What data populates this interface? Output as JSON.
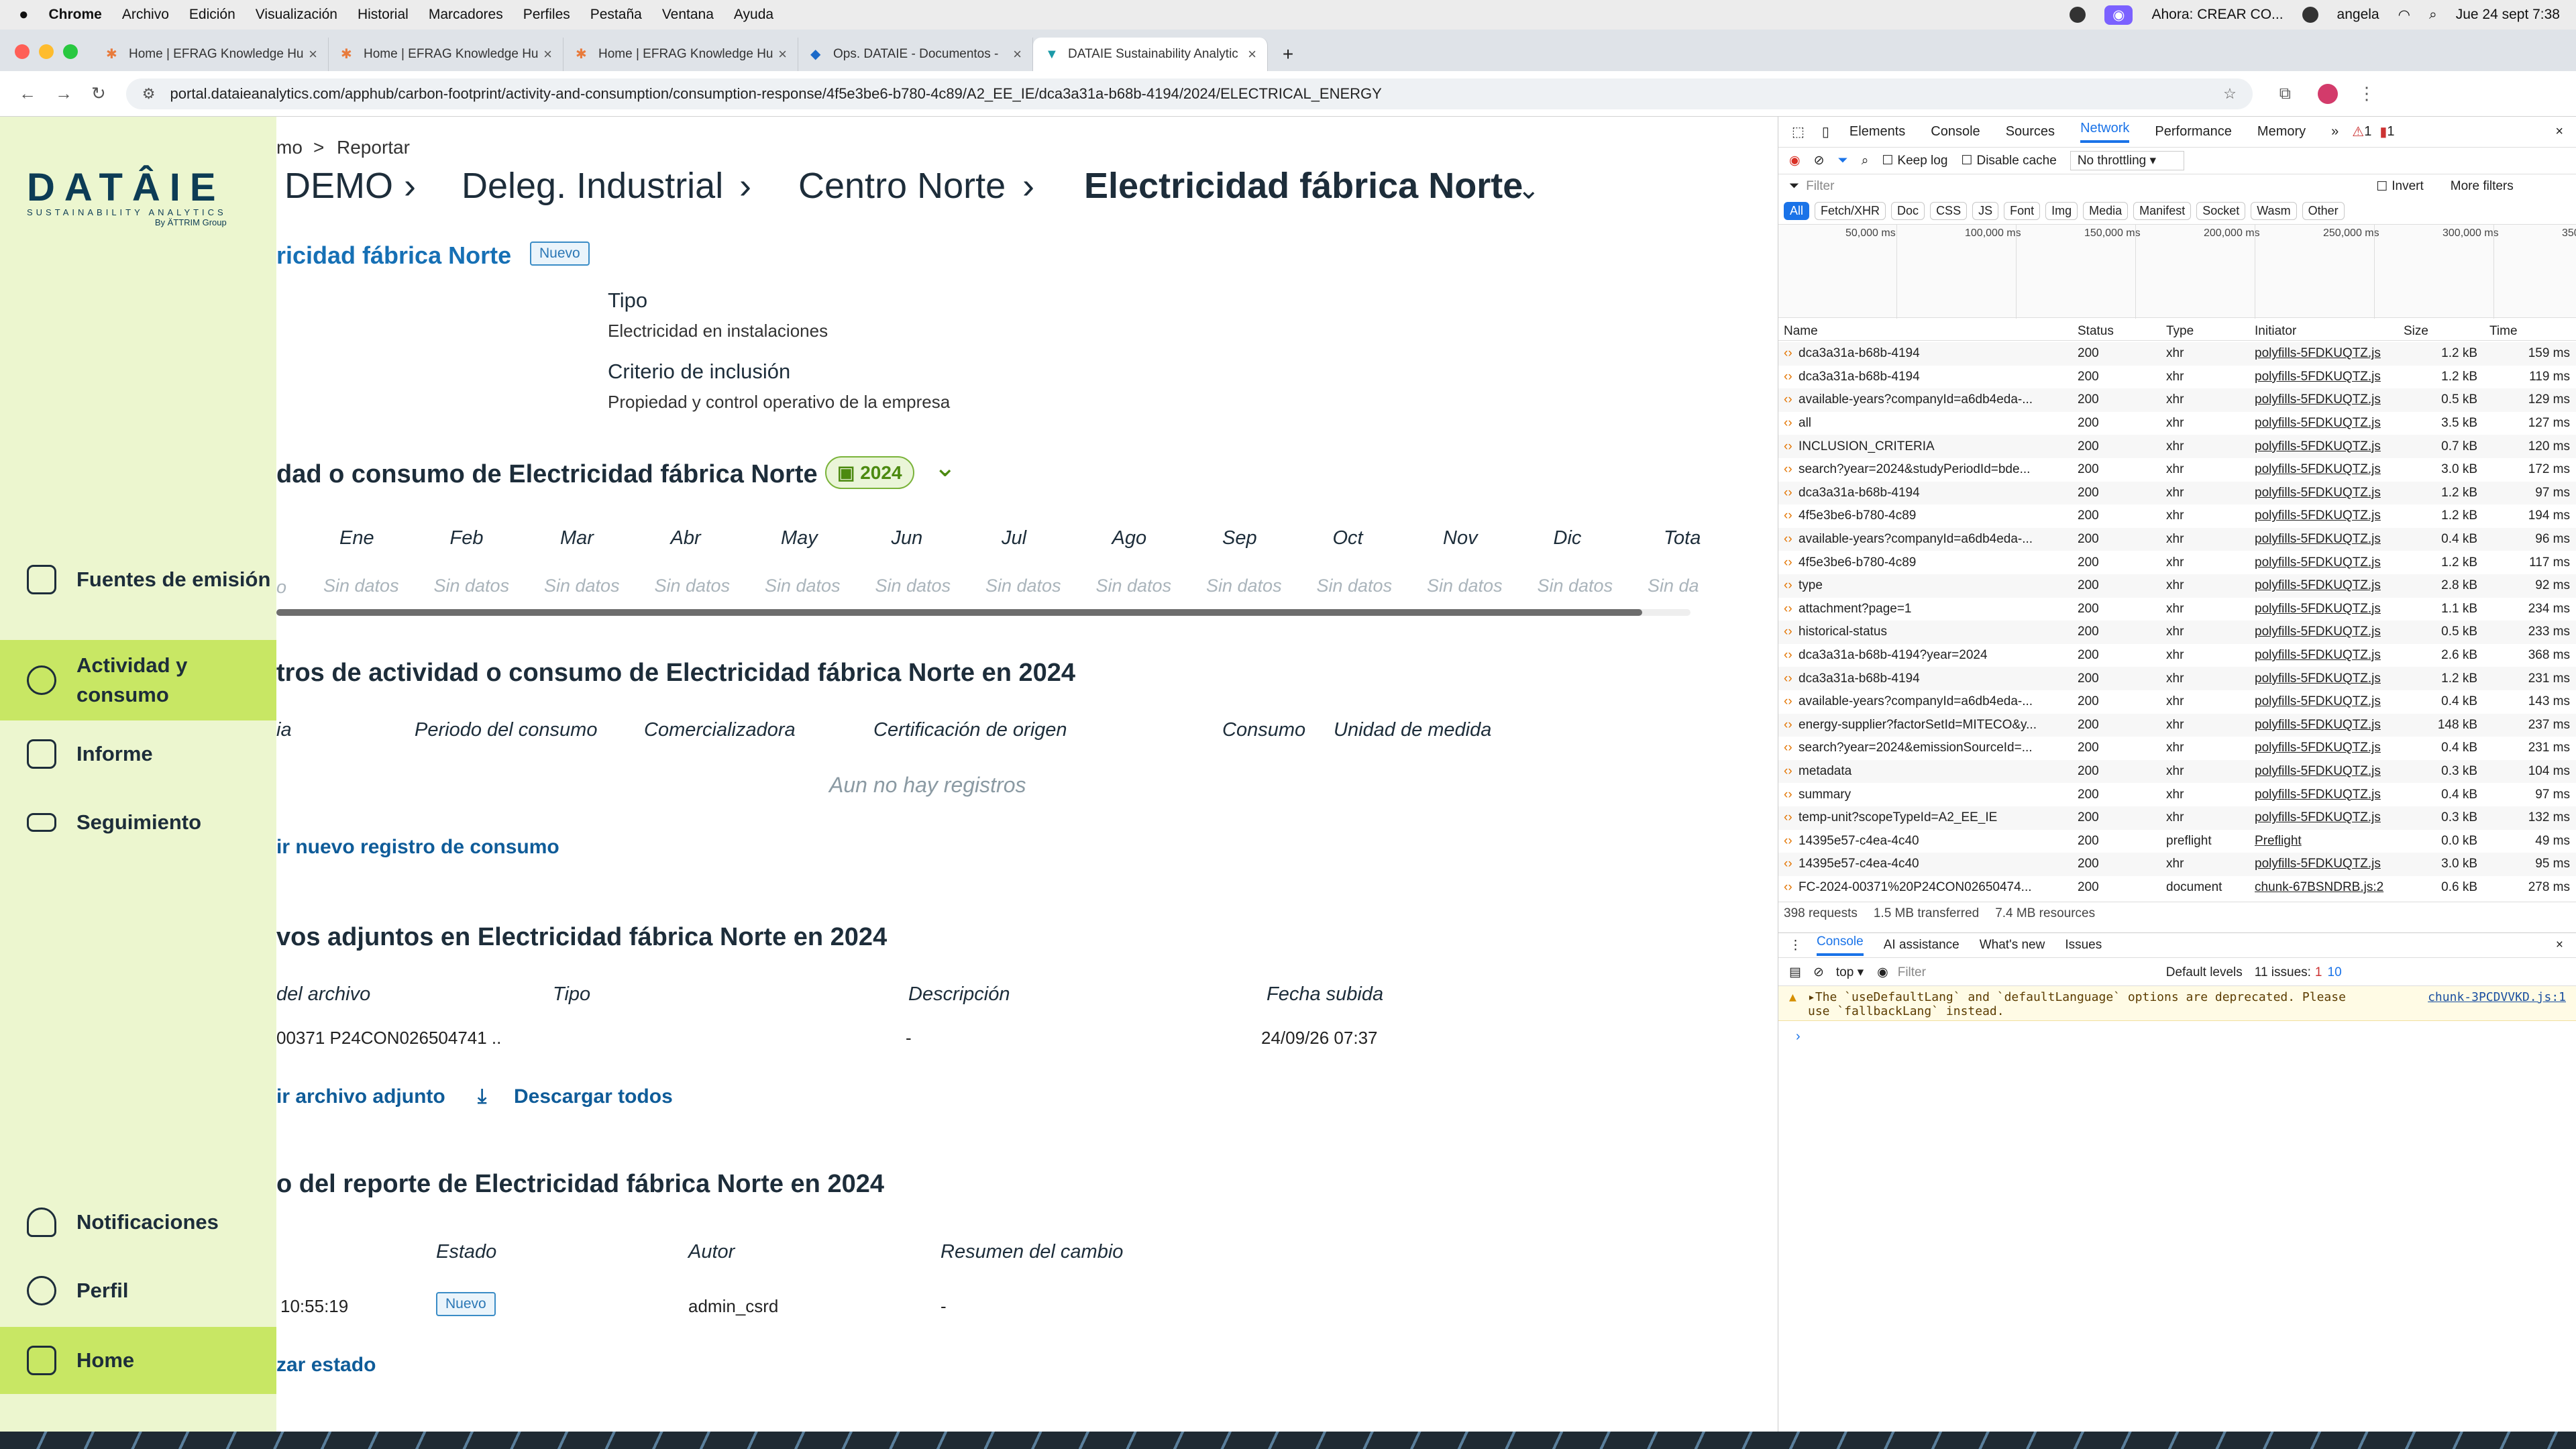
{
  "menubar": {
    "app": "Chrome",
    "items": [
      "Archivo",
      "Edición",
      "Visualización",
      "Historial",
      "Marcadores",
      "Perfiles",
      "Pestaña",
      "Ventana",
      "Ayuda"
    ],
    "now_playing": "Ahora: CREAR CO...",
    "user": "angela",
    "datetime": "Jue 24 sept 7:38"
  },
  "tabs": [
    {
      "label": "Home | EFRAG Knowledge Hu"
    },
    {
      "label": "Home | EFRAG Knowledge Hu"
    },
    {
      "label": "Home | EFRAG Knowledge Hu"
    },
    {
      "label": "Ops. DATAIE - Documentos -"
    },
    {
      "label": "DATAIE Sustainability Analytic"
    }
  ],
  "url": "portal.dataieanalytics.com/apphub/carbon-footprint/activity-and-consumption/consumption-response/4f5e3be6-b780-4c89/A2_EE_IE/dca3a31a-b68b-4194/2024/ELECTRICAL_ENERGY",
  "logo": {
    "word": "DATÂIE",
    "sub": "SUSTAINABILITY ANALYTICS",
    "by": "By ÄTTRIM Group"
  },
  "nav": {
    "fuentes": "Fuentes de emisión",
    "actividad": "Actividad y consumo",
    "informe": "Informe",
    "seguimiento": "Seguimiento",
    "notificaciones": "Notificaciones",
    "perfil": "Perfil",
    "home": "Home"
  },
  "breadcrumb": {
    "small_prev": "mo",
    "small_sep": ">",
    "small_current": "Reportar",
    "path": [
      "DEMO",
      "Deleg. Industrial",
      "Centro Norte"
    ],
    "current": "Electricidad fábrica Norte"
  },
  "source": {
    "title": "ricidad fábrica Norte",
    "badge": "Nuevo",
    "tipo_label": "Tipo",
    "tipo_value": "Electricidad en instalaciones",
    "criterio_label": "Criterio de inclusión",
    "criterio_value": "Propiedad y control operativo de la empresa"
  },
  "monthly": {
    "title": "dad o consumo de Electricidad fábrica Norte",
    "year": "2024",
    "months": [
      "Ene",
      "Feb",
      "Mar",
      "Abr",
      "May",
      "Jun",
      "Jul",
      "Ago",
      "Sep",
      "Oct",
      "Nov",
      "Dic",
      "Tota"
    ],
    "row_first": "o",
    "empty": "Sin datos",
    "total_empty": "Sin da"
  },
  "records": {
    "title": "tros de actividad o consumo de Electricidad fábrica Norte en 2024",
    "cols": [
      "ia",
      "Periodo del consumo",
      "Comercializadora",
      "Certificación de origen",
      "Consumo",
      "Unidad de medida"
    ],
    "empty": "Aun no hay registros",
    "add": "ir nuevo registro de consumo"
  },
  "attachments": {
    "title": "vos adjuntos en Electricidad fábrica Norte en 2024",
    "cols": [
      "del archivo",
      "Tipo",
      "Descripción",
      "Fecha subida"
    ],
    "row": {
      "name": "00371 P24CON026504741 ..",
      "tipo": "",
      "desc": "-",
      "fecha": "24/09/26 07:37"
    },
    "add": "ir archivo adjunto",
    "download": "Descargar todos"
  },
  "history": {
    "title": "o del reporte de Electricidad fábrica Norte en 2024",
    "cols": [
      "Estado",
      "Autor",
      "Resumen del cambio"
    ],
    "row": {
      "time": "10:55:19",
      "estado": "Nuevo",
      "autor": "admin_csrd",
      "resumen": "-"
    },
    "action": "zar estado"
  },
  "devtools": {
    "tabs": [
      "Elements",
      "Console",
      "Sources",
      "Network",
      "Performance",
      "Memory"
    ],
    "warn_count": "1",
    "err_count": "1",
    "keep_log": "Keep log",
    "disable_cache": "Disable cache",
    "throttle": "No throttling",
    "filter": "Filter",
    "invert": "Invert",
    "more_filters": "More filters",
    "types": [
      "All",
      "Fetch/XHR",
      "Doc",
      "CSS",
      "JS",
      "Font",
      "Img",
      "Media",
      "Manifest",
      "Socket",
      "Wasm",
      "Other"
    ],
    "timeline": [
      "50,000 ms",
      "100,000 ms",
      "150,000 ms",
      "200,000 ms",
      "250,000 ms",
      "300,000 ms",
      "350"
    ],
    "headers": [
      "Name",
      "Status",
      "Type",
      "Initiator",
      "Size",
      "Time"
    ],
    "rows": [
      [
        "dca3a31a-b68b-4194",
        "200",
        "xhr",
        "polyfills-5FDKUQTZ.js",
        "1.2 kB",
        "159 ms"
      ],
      [
        "dca3a31a-b68b-4194",
        "200",
        "xhr",
        "polyfills-5FDKUQTZ.js",
        "1.2 kB",
        "119 ms"
      ],
      [
        "available-years?companyId=a6db4eda-...",
        "200",
        "xhr",
        "polyfills-5FDKUQTZ.js",
        "0.5 kB",
        "129 ms"
      ],
      [
        "all",
        "200",
        "xhr",
        "polyfills-5FDKUQTZ.js",
        "3.5 kB",
        "127 ms"
      ],
      [
        "INCLUSION_CRITERIA",
        "200",
        "xhr",
        "polyfills-5FDKUQTZ.js",
        "0.7 kB",
        "120 ms"
      ],
      [
        "search?year=2024&studyPeriodId=bde...",
        "200",
        "xhr",
        "polyfills-5FDKUQTZ.js",
        "3.0 kB",
        "172 ms"
      ],
      [
        "dca3a31a-b68b-4194",
        "200",
        "xhr",
        "polyfills-5FDKUQTZ.js",
        "1.2 kB",
        "97 ms"
      ],
      [
        "4f5e3be6-b780-4c89",
        "200",
        "xhr",
        "polyfills-5FDKUQTZ.js",
        "1.2 kB",
        "194 ms"
      ],
      [
        "available-years?companyId=a6db4eda-...",
        "200",
        "xhr",
        "polyfills-5FDKUQTZ.js",
        "0.4 kB",
        "96 ms"
      ],
      [
        "4f5e3be6-b780-4c89",
        "200",
        "xhr",
        "polyfills-5FDKUQTZ.js",
        "1.2 kB",
        "117 ms"
      ],
      [
        "type",
        "200",
        "xhr",
        "polyfills-5FDKUQTZ.js",
        "2.8 kB",
        "92 ms"
      ],
      [
        "attachment?page=1",
        "200",
        "xhr",
        "polyfills-5FDKUQTZ.js",
        "1.1 kB",
        "234 ms"
      ],
      [
        "historical-status",
        "200",
        "xhr",
        "polyfills-5FDKUQTZ.js",
        "0.5 kB",
        "233 ms"
      ],
      [
        "dca3a31a-b68b-4194?year=2024",
        "200",
        "xhr",
        "polyfills-5FDKUQTZ.js",
        "2.6 kB",
        "368 ms"
      ],
      [
        "dca3a31a-b68b-4194",
        "200",
        "xhr",
        "polyfills-5FDKUQTZ.js",
        "1.2 kB",
        "231 ms"
      ],
      [
        "available-years?companyId=a6db4eda-...",
        "200",
        "xhr",
        "polyfills-5FDKUQTZ.js",
        "0.4 kB",
        "143 ms"
      ],
      [
        "energy-supplier?factorSetId=MITECO&y...",
        "200",
        "xhr",
        "polyfills-5FDKUQTZ.js",
        "148 kB",
        "237 ms"
      ],
      [
        "search?year=2024&emissionSourceId=...",
        "200",
        "xhr",
        "polyfills-5FDKUQTZ.js",
        "0.4 kB",
        "231 ms"
      ],
      [
        "metadata",
        "200",
        "xhr",
        "polyfills-5FDKUQTZ.js",
        "0.3 kB",
        "104 ms"
      ],
      [
        "summary",
        "200",
        "xhr",
        "polyfills-5FDKUQTZ.js",
        "0.4 kB",
        "97 ms"
      ],
      [
        "temp-unit?scopeTypeId=A2_EE_IE",
        "200",
        "xhr",
        "polyfills-5FDKUQTZ.js",
        "0.3 kB",
        "132 ms"
      ],
      [
        "14395e57-c4ea-4c40",
        "200",
        "preflight",
        "Preflight",
        "0.0 kB",
        "49 ms"
      ],
      [
        "14395e57-c4ea-4c40",
        "200",
        "xhr",
        "polyfills-5FDKUQTZ.js",
        "3.0 kB",
        "95 ms"
      ],
      [
        "FC-2024-00371%20P24CON02650474...",
        "200",
        "document",
        "chunk-67BSNDRB.js:2",
        "0.6 kB",
        "278 ms"
      ]
    ],
    "summary": [
      "398 requests",
      "1.5 MB transferred",
      "7.4 MB resources"
    ],
    "drawer_tabs": [
      "Console",
      "AI assistance",
      "What's new",
      "Issues"
    ],
    "context": "top",
    "console_filter": "Filter",
    "levels": "Default levels",
    "issues": "11 issues:",
    "issues_a": "1",
    "issues_b": "10",
    "warning": "▸The `useDefaultLang` and `defaultLanguage` options are deprecated. Please use `fallbackLang` instead.",
    "warning_src": "chunk-3PCDVVKD.js:1",
    "prompt": "›"
  }
}
